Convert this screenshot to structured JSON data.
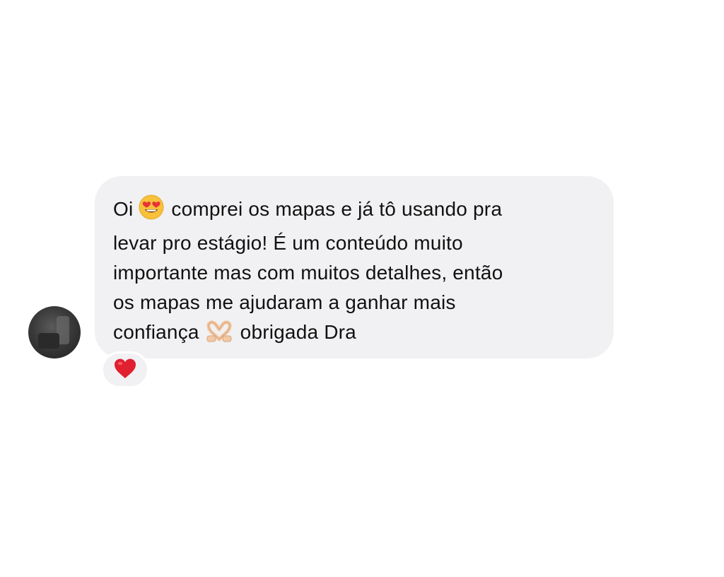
{
  "message": {
    "line1_a": "Oi",
    "emoji1": "heart-eyes-emoji",
    "line1_b": "comprei os mapas e já tô usando pra",
    "line2": "levar pro estágio! É um conteúdo muito",
    "line3": "importante mas com muitos detalhes, então",
    "line4": "os mapas me ajudaram a ganhar mais",
    "line5_a": "confiança",
    "emoji2": "heart-hands-emoji",
    "line5_b": "obrigada Dra"
  },
  "reaction": {
    "emoji": "red-heart-emoji"
  },
  "colors": {
    "bubble_bg": "#f1f1f3",
    "text": "#111111",
    "heart": "#e0202e"
  }
}
